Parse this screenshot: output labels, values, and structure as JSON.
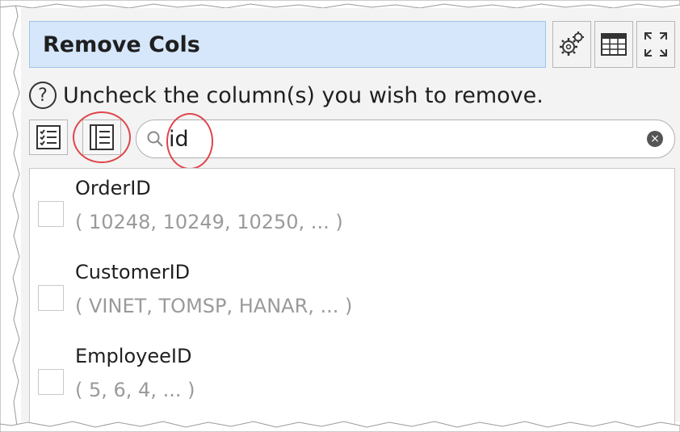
{
  "panel": {
    "title": "Remove Cols",
    "buttons": {
      "settings_icon": "gears-icon",
      "table_icon": "table-icon",
      "maximize_icon": "maximize-icon"
    }
  },
  "help": {
    "icon_glyph": "?",
    "text": "Uncheck the column(s) you wish to remove."
  },
  "toolbar": {
    "check_all_icon": "checklist-icon",
    "list_view_icon": "list-view-icon",
    "search_icon": "search-icon",
    "search_value": "id",
    "clear_glyph": "×"
  },
  "columns": [
    {
      "name": "OrderID",
      "sample": "( 10248, 10249, 10250, ... )",
      "checked": false
    },
    {
      "name": "CustomerID",
      "sample": "( VINET, TOMSP, HANAR, ... )",
      "checked": false
    },
    {
      "name": "EmployeeID",
      "sample": "( 5, 6, 4, ... )",
      "checked": false
    }
  ],
  "colors": {
    "title_bg": "#d6e7fb",
    "highlight": "#e0454a",
    "sample_text": "#9a9a9a"
  }
}
